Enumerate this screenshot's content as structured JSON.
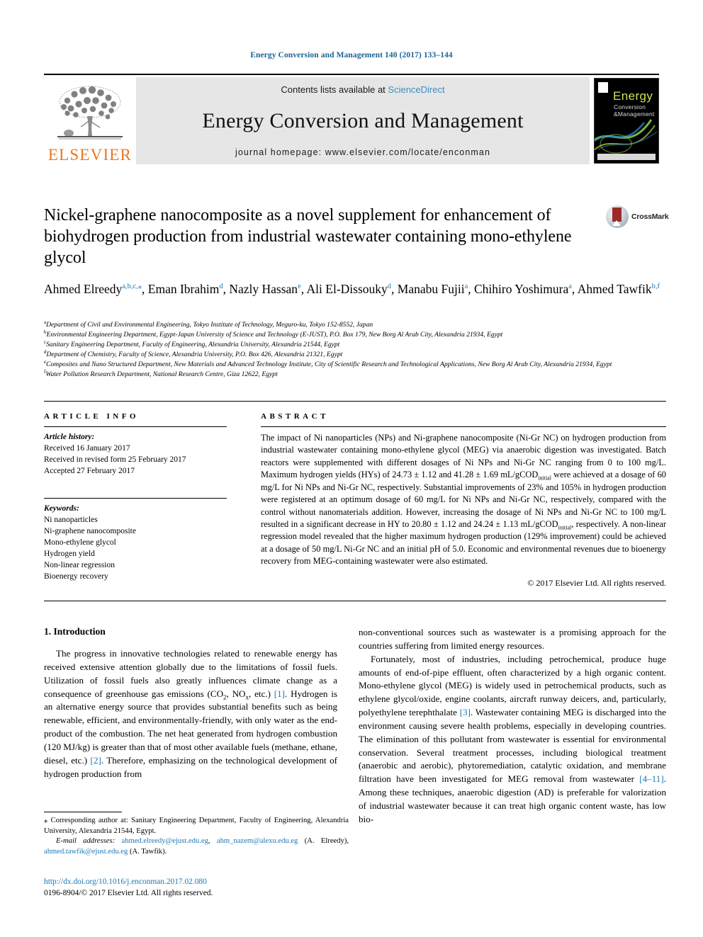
{
  "running_head": "Energy Conversion and Management 140 (2017) 133–144",
  "masthead": {
    "publisher_name": "ELSEVIER",
    "contents_prefix": "Contents lists available at ",
    "contents_link": "ScienceDirect",
    "journal_title": "Energy Conversion and Management",
    "homepage": "journal homepage: www.elsevier.com/locate/enconman",
    "cover": {
      "title": "Energy",
      "sub1": "Conversion",
      "sub2": "&Management"
    }
  },
  "crossmark": {
    "label": "CrossMark"
  },
  "article": {
    "title": "Nickel-graphene nanocomposite as a novel supplement for enhancement of biohydrogen production from industrial wastewater containing mono-ethylene glycol",
    "authors": [
      {
        "name": "Ahmed Elreedy",
        "marks": "a,b,c,⁎",
        "sep": ", "
      },
      {
        "name": "Eman Ibrahim",
        "marks": "d",
        "sep": ", "
      },
      {
        "name": "Nazly Hassan",
        "marks": "e",
        "sep": ", "
      },
      {
        "name": "Ali El-Dissouky",
        "marks": "d",
        "sep": ", "
      },
      {
        "name": "Manabu Fujii",
        "marks": "a",
        "sep": ", "
      },
      {
        "name": "Chihiro Yoshimura",
        "marks": "a",
        "sep": ", "
      },
      {
        "name": "Ahmed Tawfik",
        "marks": "b,f",
        "sep": ""
      }
    ],
    "affiliations": [
      {
        "mark": "a",
        "text": "Department of Civil and Environmental Engineering, Tokyo Institute of Technology, Meguro-ku, Tokyo 152-8552, Japan"
      },
      {
        "mark": "b",
        "text": "Environmental Engineering Department, Egypt-Japan University of Science and Technology (E-JUST), P.O. Box 179, New Borg Al Arab City, Alexandria 21934, Egypt"
      },
      {
        "mark": "c",
        "text": "Sanitary Engineering Department, Faculty of Engineering, Alexandria University, Alexandria 21544, Egypt"
      },
      {
        "mark": "d",
        "text": "Department of Chemistry, Faculty of Science, Alexandria University, P.O. Box 426, Alexandria 21321, Egypt"
      },
      {
        "mark": "e",
        "text": "Composites and Nano Structured Department, New Materials and Advanced Technology Institute, City of Scientific Research and Technological Applications, New Borg Al Arab City, Alexandria 21934, Egypt"
      },
      {
        "mark": "f",
        "text": "Water Pollution Research Department, National Research Centre, Giza 12622, Egypt"
      }
    ]
  },
  "article_info": {
    "heading": "ARTICLE INFO",
    "history_label": "Article history:",
    "history": [
      "Received 16 January 2017",
      "Received in revised form 25 February 2017",
      "Accepted 27 February 2017"
    ],
    "keywords_label": "Keywords:",
    "keywords": [
      "Ni nanoparticles",
      "Ni-graphene nanocomposite",
      "Mono-ethylene glycol",
      "Hydrogen yield",
      "Non-linear regression",
      "Bioenergy recovery"
    ]
  },
  "abstract": {
    "heading": "ABSTRACT",
    "part1": "The impact of Ni nanoparticles (NPs) and Ni-graphene nanocomposite (Ni-Gr NC) on hydrogen production from industrial wastewater containing mono-ethylene glycol (MEG) via anaerobic digestion was investigated. Batch reactors were supplemented with different dosages of Ni NPs and Ni-Gr NC ranging from 0 to 100 mg/L. Maximum hydrogen yields (HYs) of 24.73 ± 1.12 and 41.28 ± 1.69 mL/gCOD",
    "sub1": "initial",
    "part2": " were achieved at a dosage of 60 mg/L for Ni NPs and Ni-Gr NC, respectively. Substantial improvements of 23% and 105% in hydrogen production were registered at an optimum dosage of 60 mg/L for Ni NPs and Ni-Gr NC, respectively, compared with the control without nanomaterials addition. However, increasing the dosage of Ni NPs and Ni-Gr NC to 100 mg/L resulted in a significant decrease in HY to 20.80 ± 1.12 and 24.24 ± 1.13 mL/gCOD",
    "sub2": "initial",
    "part3": ", respectively. A non-linear regression model revealed that the higher maximum hydrogen production (129% improvement) could be achieved at a dosage of 50 mg/L Ni-Gr NC and an initial pH of 5.0. Economic and environmental revenues due to bioenergy recovery from MEG-containing wastewater were also estimated.",
    "copyright": "© 2017 Elsevier Ltd. All rights reserved."
  },
  "body": {
    "section_title": "1. Introduction",
    "left_p1_a": "The progress in innovative technologies related to renewable energy has received extensive attention globally due to the limitations of fossil fuels. Utilization of fossil fuels also greatly influences climate change as a consequence of greenhouse gas emissions (CO",
    "left_p1_sub1": "2",
    "left_p1_b": ", NO",
    "left_p1_sub2": "x",
    "left_p1_c": ", etc.) ",
    "left_p1_ref1": "[1]",
    "left_p1_d": ". Hydrogen is an alternative energy source that provides substantial benefits such as being renewable, efficient, and environmentally-friendly, with only water as the end-product of the combustion. The net heat generated from hydrogen combustion (120 MJ/kg) is greater than that of most other available fuels (methane, ethane, diesel, etc.) ",
    "left_p1_ref2": "[2]",
    "left_p1_e": ". Therefore, emphasizing on the technological development of hydrogen production from",
    "right_p1": "non-conventional sources such as wastewater is a promising approach for the countries suffering from limited energy resources.",
    "right_p2_a": "Fortunately, most of industries, including petrochemical, produce huge amounts of end-of-pipe effluent, often characterized by a high organic content. Mono-ethylene glycol (MEG) is widely used in petrochemical products, such as ethylene glycol/oxide, engine coolants, aircraft runway deicers, and, particularly, polyethylene terephthalate ",
    "right_p2_ref1": "[3]",
    "right_p2_b": ". Wastewater containing MEG is discharged into the environment causing severe health problems, especially in developing countries. The elimination of this pollutant from wastewater is essential for environmental conservation. Several treatment processes, including biological treatment (anaerobic and aerobic), phytoremediation, catalytic oxidation, and membrane filtration have been investigated for MEG removal from wastewater ",
    "right_p2_ref2": "[4–11]",
    "right_p2_c": ". Among these techniques, anaerobic digestion (AD) is preferable for valorization of industrial wastewater because it can treat high organic content waste, has low bio-"
  },
  "footnote": {
    "star": "⁎",
    "corresponding": " Corresponding author at: Sanitary Engineering Department, Faculty of Engineering, Alexandria University, Alexandria 21544, Egypt.",
    "email_label": "E-mail addresses:",
    "email1": "ahmed.elreedy@ejust.edu.eg",
    "email2": "ahm_nazem@alexu.edu.eg",
    "email_name1": " (A. Elreedy), ",
    "email3": "ahmed.tawfik@ejust.edu.eg",
    "email_name2": " (A. Tawfik)."
  },
  "doi_block": {
    "doi": "http://dx.doi.org/10.1016/j.enconman.2017.02.080",
    "issn_line": "0196-8904/© 2017 Elsevier Ltd. All rights reserved."
  },
  "colors": {
    "link": "#1a78b5",
    "running_head": "#1a6496",
    "elsevier_orange": "#E87722",
    "masthead_bg": "#e6e6e6"
  }
}
